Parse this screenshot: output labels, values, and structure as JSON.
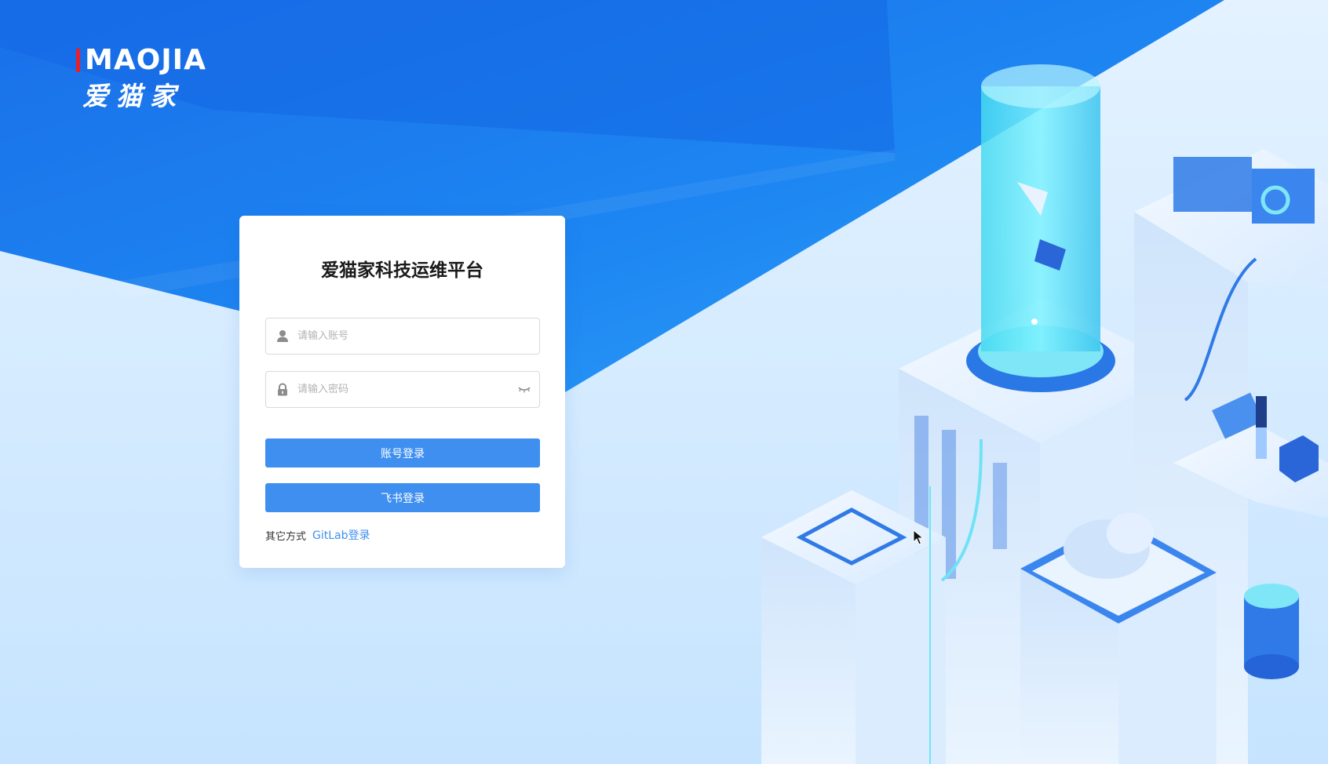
{
  "brand": {
    "logo_en": "MAOJIA",
    "logo_cn": "爱猫家",
    "accent_color": "#e8202a"
  },
  "login": {
    "title": "爱猫家科技运维平台",
    "username_placeholder": "请输入账号",
    "password_placeholder": "请输入密码",
    "account_login_label": "账号登录",
    "feishu_login_label": "飞书登录",
    "other_methods_label": "其它方式",
    "gitlab_login_label": "GitLab登录"
  },
  "theme": {
    "primary_blue": "#3f8ff0",
    "hero_blue": "#1273ec",
    "background_light": "#d4ebff"
  },
  "icons": {
    "username": "user-icon",
    "password": "lock-icon",
    "toggle_visibility": "eye-closed-icon",
    "pointer": "mouse-cursor-icon"
  }
}
